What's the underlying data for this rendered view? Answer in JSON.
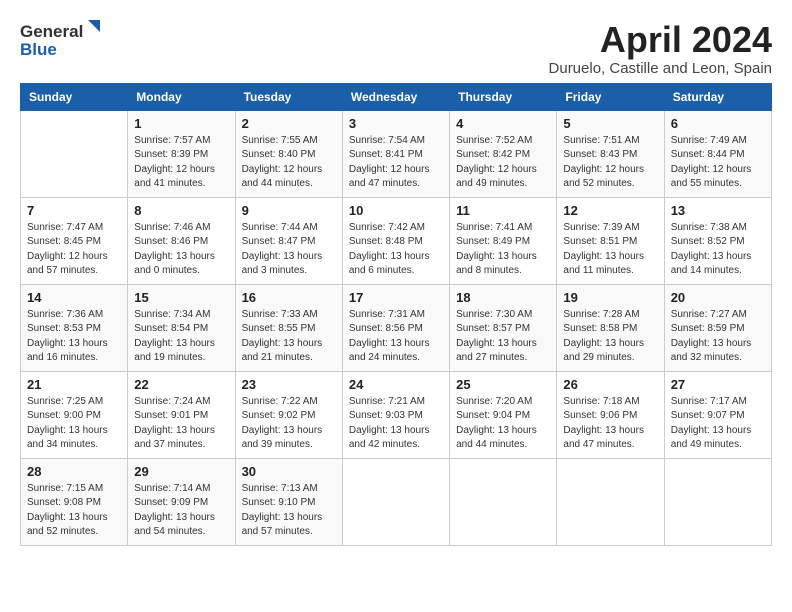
{
  "header": {
    "logo_general": "General",
    "logo_blue": "Blue",
    "month_title": "April 2024",
    "location": "Duruelo, Castille and Leon, Spain"
  },
  "weekdays": [
    "Sunday",
    "Monday",
    "Tuesday",
    "Wednesday",
    "Thursday",
    "Friday",
    "Saturday"
  ],
  "weeks": [
    [
      {
        "day": "",
        "info": ""
      },
      {
        "day": "1",
        "info": "Sunrise: 7:57 AM\nSunset: 8:39 PM\nDaylight: 12 hours\nand 41 minutes."
      },
      {
        "day": "2",
        "info": "Sunrise: 7:55 AM\nSunset: 8:40 PM\nDaylight: 12 hours\nand 44 minutes."
      },
      {
        "day": "3",
        "info": "Sunrise: 7:54 AM\nSunset: 8:41 PM\nDaylight: 12 hours\nand 47 minutes."
      },
      {
        "day": "4",
        "info": "Sunrise: 7:52 AM\nSunset: 8:42 PM\nDaylight: 12 hours\nand 49 minutes."
      },
      {
        "day": "5",
        "info": "Sunrise: 7:51 AM\nSunset: 8:43 PM\nDaylight: 12 hours\nand 52 minutes."
      },
      {
        "day": "6",
        "info": "Sunrise: 7:49 AM\nSunset: 8:44 PM\nDaylight: 12 hours\nand 55 minutes."
      }
    ],
    [
      {
        "day": "7",
        "info": "Sunrise: 7:47 AM\nSunset: 8:45 PM\nDaylight: 12 hours\nand 57 minutes."
      },
      {
        "day": "8",
        "info": "Sunrise: 7:46 AM\nSunset: 8:46 PM\nDaylight: 13 hours\nand 0 minutes."
      },
      {
        "day": "9",
        "info": "Sunrise: 7:44 AM\nSunset: 8:47 PM\nDaylight: 13 hours\nand 3 minutes."
      },
      {
        "day": "10",
        "info": "Sunrise: 7:42 AM\nSunset: 8:48 PM\nDaylight: 13 hours\nand 6 minutes."
      },
      {
        "day": "11",
        "info": "Sunrise: 7:41 AM\nSunset: 8:49 PM\nDaylight: 13 hours\nand 8 minutes."
      },
      {
        "day": "12",
        "info": "Sunrise: 7:39 AM\nSunset: 8:51 PM\nDaylight: 13 hours\nand 11 minutes."
      },
      {
        "day": "13",
        "info": "Sunrise: 7:38 AM\nSunset: 8:52 PM\nDaylight: 13 hours\nand 14 minutes."
      }
    ],
    [
      {
        "day": "14",
        "info": "Sunrise: 7:36 AM\nSunset: 8:53 PM\nDaylight: 13 hours\nand 16 minutes."
      },
      {
        "day": "15",
        "info": "Sunrise: 7:34 AM\nSunset: 8:54 PM\nDaylight: 13 hours\nand 19 minutes."
      },
      {
        "day": "16",
        "info": "Sunrise: 7:33 AM\nSunset: 8:55 PM\nDaylight: 13 hours\nand 21 minutes."
      },
      {
        "day": "17",
        "info": "Sunrise: 7:31 AM\nSunset: 8:56 PM\nDaylight: 13 hours\nand 24 minutes."
      },
      {
        "day": "18",
        "info": "Sunrise: 7:30 AM\nSunset: 8:57 PM\nDaylight: 13 hours\nand 27 minutes."
      },
      {
        "day": "19",
        "info": "Sunrise: 7:28 AM\nSunset: 8:58 PM\nDaylight: 13 hours\nand 29 minutes."
      },
      {
        "day": "20",
        "info": "Sunrise: 7:27 AM\nSunset: 8:59 PM\nDaylight: 13 hours\nand 32 minutes."
      }
    ],
    [
      {
        "day": "21",
        "info": "Sunrise: 7:25 AM\nSunset: 9:00 PM\nDaylight: 13 hours\nand 34 minutes."
      },
      {
        "day": "22",
        "info": "Sunrise: 7:24 AM\nSunset: 9:01 PM\nDaylight: 13 hours\nand 37 minutes."
      },
      {
        "day": "23",
        "info": "Sunrise: 7:22 AM\nSunset: 9:02 PM\nDaylight: 13 hours\nand 39 minutes."
      },
      {
        "day": "24",
        "info": "Sunrise: 7:21 AM\nSunset: 9:03 PM\nDaylight: 13 hours\nand 42 minutes."
      },
      {
        "day": "25",
        "info": "Sunrise: 7:20 AM\nSunset: 9:04 PM\nDaylight: 13 hours\nand 44 minutes."
      },
      {
        "day": "26",
        "info": "Sunrise: 7:18 AM\nSunset: 9:06 PM\nDaylight: 13 hours\nand 47 minutes."
      },
      {
        "day": "27",
        "info": "Sunrise: 7:17 AM\nSunset: 9:07 PM\nDaylight: 13 hours\nand 49 minutes."
      }
    ],
    [
      {
        "day": "28",
        "info": "Sunrise: 7:15 AM\nSunset: 9:08 PM\nDaylight: 13 hours\nand 52 minutes."
      },
      {
        "day": "29",
        "info": "Sunrise: 7:14 AM\nSunset: 9:09 PM\nDaylight: 13 hours\nand 54 minutes."
      },
      {
        "day": "30",
        "info": "Sunrise: 7:13 AM\nSunset: 9:10 PM\nDaylight: 13 hours\nand 57 minutes."
      },
      {
        "day": "",
        "info": ""
      },
      {
        "day": "",
        "info": ""
      },
      {
        "day": "",
        "info": ""
      },
      {
        "day": "",
        "info": ""
      }
    ]
  ]
}
